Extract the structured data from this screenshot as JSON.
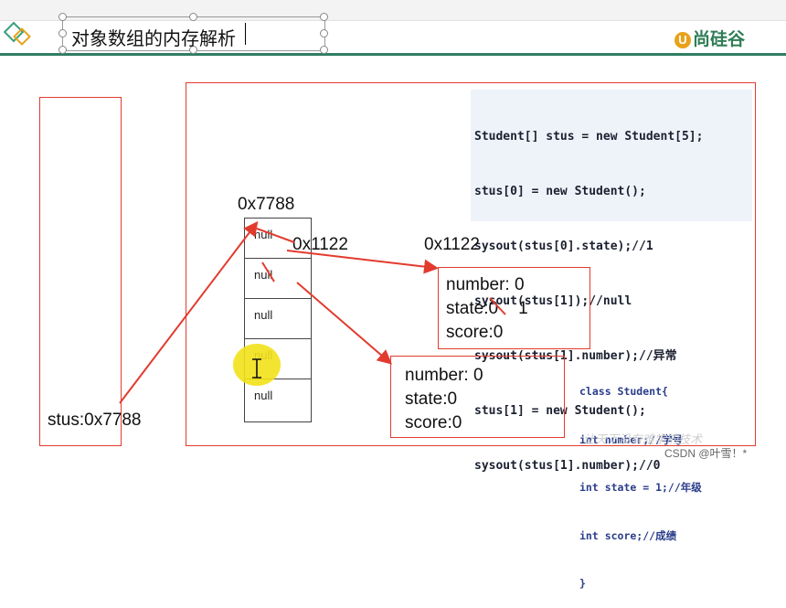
{
  "slide": {
    "title": "对象数组的内存解析",
    "logo_text": "尚硅谷",
    "logo_badge": "U"
  },
  "stack": {
    "label": "stus:0x7788"
  },
  "heap": {
    "array_address": "0x7788",
    "array_cells": [
      "null",
      "null",
      "null",
      "null",
      "null"
    ],
    "ref_address": "0x1122",
    "object_address": "0x1122",
    "object1": {
      "number": "number: 0",
      "state_prefix": "state:",
      "state_old": "0",
      "state_new": "1",
      "score": "score:0"
    },
    "object2": {
      "number": "number: 0",
      "state": "state:0",
      "score": "score:0"
    }
  },
  "code": {
    "lines": [
      "Student[] stus = new Student[5];",
      "stus[0] = new Student();",
      "sysout(stus[0].state);//1",
      "sysout(stus[1]);//null",
      "sysout(stus[1].number);//异常",
      "stus[1] = new Student();",
      "sysout(stus[1].number);//0"
    ]
  },
  "class_def": {
    "lines": [
      "class Student{",
      "int number;//学号",
      "int state = 1;//年级",
      "int score;//成绩",
      "}"
    ]
  },
  "footer": {
    "faded_text": "让天下没有难学的技术",
    "watermark": "CSDN @叶雪！*"
  },
  "colors": {
    "accent_red": "#e23b2e",
    "brand_green": "#2e7d55",
    "cursor_yellow": "#f2e11a"
  }
}
